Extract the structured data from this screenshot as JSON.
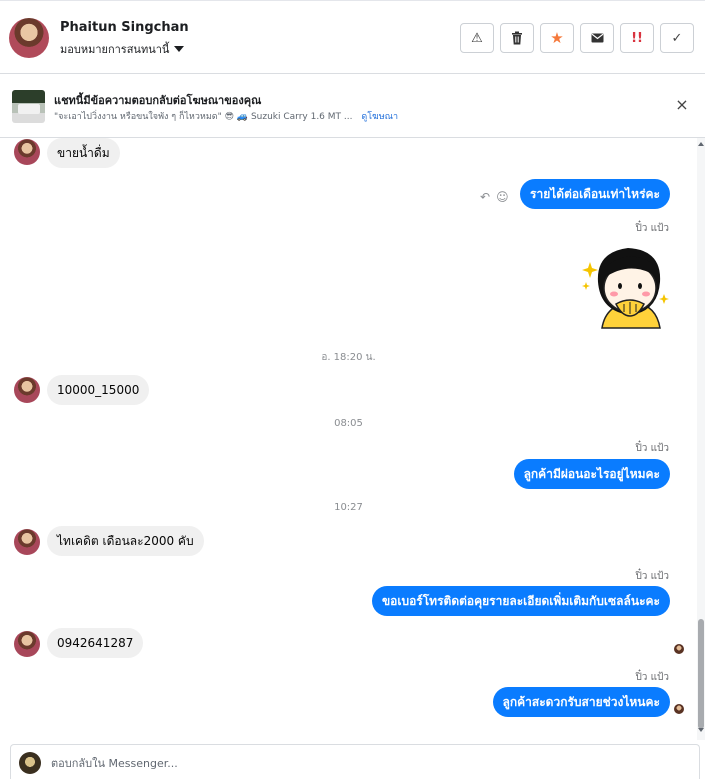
{
  "header": {
    "customer_name": "Phaitun Singchan",
    "assign_label": "มอบหมายการสนทนานี้",
    "actions": {
      "spam": "⚠",
      "delete": "🗑",
      "star": "★",
      "mail": "✉",
      "urgent": "!!",
      "done": "✓"
    },
    "colors": {
      "star": "#f5793b",
      "urgent": "#d9333f"
    }
  },
  "ad_banner": {
    "title": "แชทนี้มีข้อความตอบกลับต่อโฆษณาของคุณ",
    "subtitle": "\"จะเอาไปวิ่งงาน หรือขนใจพัง ๆ ก็ไหวหมด\" 😎 🚙 Suzuki Carry 1.6 MT ...",
    "link": "ดูโฆษณา",
    "close_icon": "×"
  },
  "messages": {
    "m1": "ขายน้ำดื่ม",
    "m2": "รายได้ต่อเดือนเท่าไหร่คะ",
    "sender": "ปิ๋ว แป้ว",
    "ts1": "อ. 18:20 น.",
    "m3": "10000_15000",
    "ts2": "08:05",
    "m4": "ลูกค้ามีผ่อนอะไรอยู่ไหมคะ",
    "ts3": "10:27",
    "m5": "ไทเคดิต เดือนละ2000 คับ",
    "m6": "ขอเบอร์โทรติดต่อคุยรายละเอียดเพิ่มเติมกับเซลล์นะคะ",
    "m7": "0942641287",
    "m8": "ลูกค้าสะดวกรับสายช่วงไหนคะ"
  },
  "composer": {
    "placeholder": "ตอบกลับใน Messenger..."
  },
  "colors": {
    "outgoing_bubble": "#0a7cff",
    "incoming_bubble": "#f0f0f0",
    "link": "#216fdb"
  }
}
